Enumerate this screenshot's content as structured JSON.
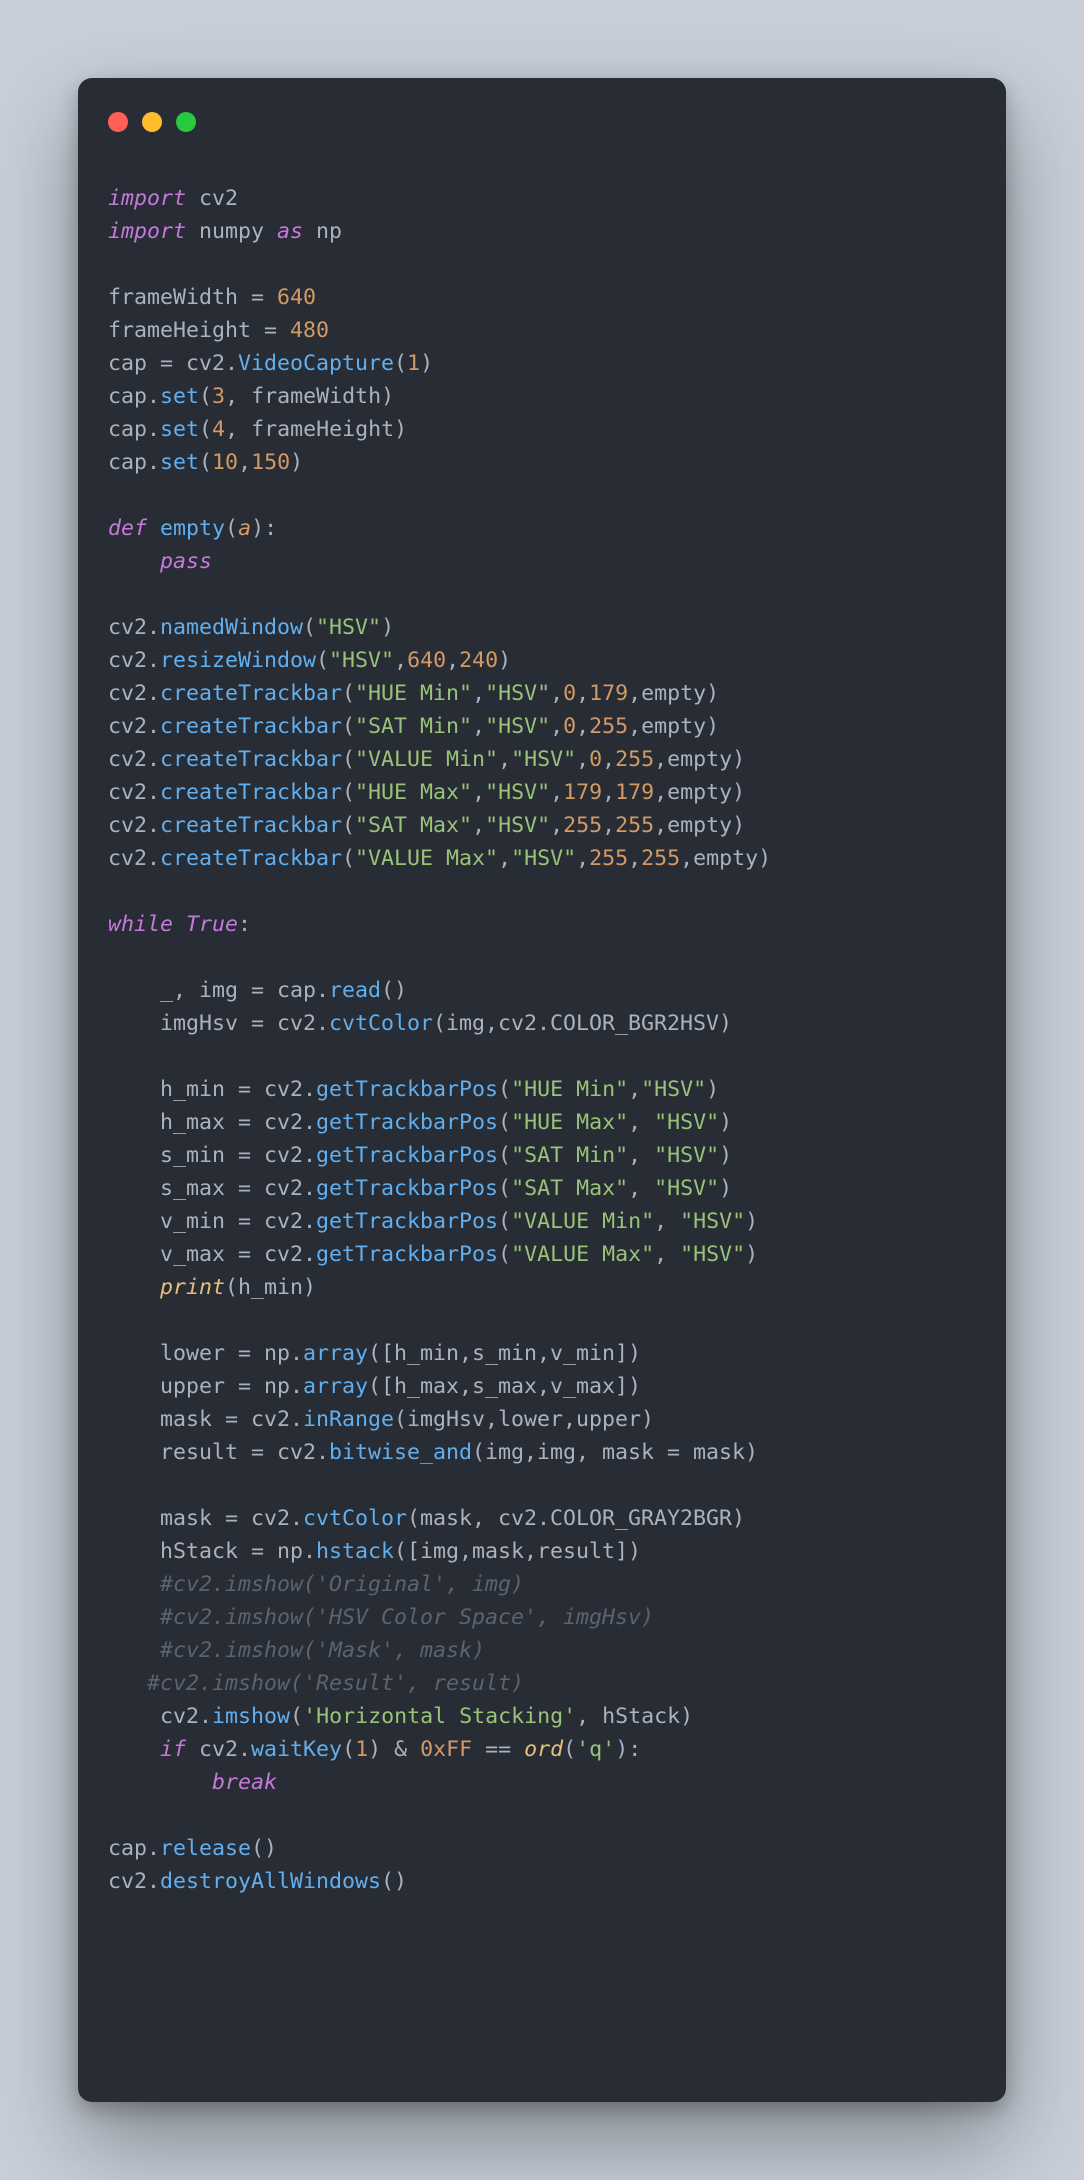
{
  "window": {
    "variant": "mac",
    "dots": [
      "red",
      "yellow",
      "green"
    ]
  },
  "code": {
    "l01_import": "import",
    "l01_cv2": " cv2",
    "l02_import": "import",
    "l02_numpy": " numpy ",
    "l02_as": "as",
    "l02_np": " np",
    "l04_fw": "frameWidth = ",
    "l04_640": "640",
    "l05_fh": "frameHeight = ",
    "l05_480": "480",
    "l06_a": "cap = cv2.",
    "l06_vc": "VideoCapture",
    "l06_p1": "(",
    "l06_1": "1",
    "l06_p2": ")",
    "l07_a": "cap.",
    "l07_set": "set",
    "l07_p1": "(",
    "l07_3": "3",
    "l07_p2": ", frameWidth)",
    "l08_a": "cap.",
    "l08_set": "set",
    "l08_p1": "(",
    "l08_4": "4",
    "l08_p2": ", frameHeight)",
    "l09_a": "cap.",
    "l09_set": "set",
    "l09_p1": "(",
    "l09_10": "10",
    "l09_c": ",",
    "l09_150": "150",
    "l09_p2": ")",
    "l11_def": "def",
    "l11_sp": " ",
    "l11_empty": "empty",
    "l11_p1": "(",
    "l11_a": "a",
    "l11_p2": "):",
    "l12_ind": "    ",
    "l12_pass": "pass",
    "l14_a": "cv2.",
    "l14_nw": "namedWindow",
    "l14_p1": "(",
    "l14_s": "\"HSV\"",
    "l14_p2": ")",
    "l15_a": "cv2.",
    "l15_rw": "resizeWindow",
    "l15_p1": "(",
    "l15_s": "\"HSV\"",
    "l15_c1": ",",
    "l15_640": "640",
    "l15_c2": ",",
    "l15_240": "240",
    "l15_p2": ")",
    "l16_a": "cv2.",
    "l16_ct": "createTrackbar",
    "l16_p1": "(",
    "l16_s1": "\"HUE Min\"",
    "l16_c1": ",",
    "l16_s2": "\"HSV\"",
    "l16_c2": ",",
    "l16_0": "0",
    "l16_c3": ",",
    "l16_179": "179",
    "l16_p2": ",empty)",
    "l17_a": "cv2.",
    "l17_ct": "createTrackbar",
    "l17_p1": "(",
    "l17_s1": "\"SAT Min\"",
    "l17_c1": ",",
    "l17_s2": "\"HSV\"",
    "l17_c2": ",",
    "l17_0": "0",
    "l17_c3": ",",
    "l17_255": "255",
    "l17_p2": ",empty)",
    "l18_a": "cv2.",
    "l18_ct": "createTrackbar",
    "l18_p1": "(",
    "l18_s1": "\"VALUE Min\"",
    "l18_c1": ",",
    "l18_s2": "\"HSV\"",
    "l18_c2": ",",
    "l18_0": "0",
    "l18_c3": ",",
    "l18_255": "255",
    "l18_p2": ",empty)",
    "l19_a": "cv2.",
    "l19_ct": "createTrackbar",
    "l19_p1": "(",
    "l19_s1": "\"HUE Max\"",
    "l19_c1": ",",
    "l19_s2": "\"HSV\"",
    "l19_c2": ",",
    "l19_179a": "179",
    "l19_c3": ",",
    "l19_179b": "179",
    "l19_p2": ",empty)",
    "l20_a": "cv2.",
    "l20_ct": "createTrackbar",
    "l20_p1": "(",
    "l20_s1": "\"SAT Max\"",
    "l20_c1": ",",
    "l20_s2": "\"HSV\"",
    "l20_c2": ",",
    "l20_255a": "255",
    "l20_c3": ",",
    "l20_255b": "255",
    "l20_p2": ",empty)",
    "l21_a": "cv2.",
    "l21_ct": "createTrackbar",
    "l21_p1": "(",
    "l21_s1": "\"VALUE Max\"",
    "l21_c1": ",",
    "l21_s2": "\"HSV\"",
    "l21_c2": ",",
    "l21_255a": "255",
    "l21_c3": ",",
    "l21_255b": "255",
    "l21_p2": ",empty)",
    "l23_while": "while",
    "l23_sp": " ",
    "l23_true": "True",
    "l23_colon": ":",
    "l25_ind": "    ",
    "l25_txt": "_, img = cap.",
    "l25_read": "read",
    "l25_p": "()",
    "l26_ind": "    ",
    "l26_a": "imgHsv = cv2.",
    "l26_cvt": "cvtColor",
    "l26_p": "(img,cv2.COLOR_BGR2HSV)",
    "l28_ind": "    ",
    "l28_a": "h_min = cv2.",
    "l28_g": "getTrackbarPos",
    "l28_p1": "(",
    "l28_s1": "\"HUE Min\"",
    "l28_c": ",",
    "l28_s2": "\"HSV\"",
    "l28_p2": ")",
    "l29_ind": "    ",
    "l29_a": "h_max = cv2.",
    "l29_g": "getTrackbarPos",
    "l29_p1": "(",
    "l29_s1": "\"HUE Max\"",
    "l29_c": ", ",
    "l29_s2": "\"HSV\"",
    "l29_p2": ")",
    "l30_ind": "    ",
    "l30_a": "s_min = cv2.",
    "l30_g": "getTrackbarPos",
    "l30_p1": "(",
    "l30_s1": "\"SAT Min\"",
    "l30_c": ", ",
    "l30_s2": "\"HSV\"",
    "l30_p2": ")",
    "l31_ind": "    ",
    "l31_a": "s_max = cv2.",
    "l31_g": "getTrackbarPos",
    "l31_p1": "(",
    "l31_s1": "\"SAT Max\"",
    "l31_c": ", ",
    "l31_s2": "\"HSV\"",
    "l31_p2": ")",
    "l32_ind": "    ",
    "l32_a": "v_min = cv2.",
    "l32_g": "getTrackbarPos",
    "l32_p1": "(",
    "l32_s1": "\"VALUE Min\"",
    "l32_c": ", ",
    "l32_s2": "\"HSV\"",
    "l32_p2": ")",
    "l33_ind": "    ",
    "l33_a": "v_max = cv2.",
    "l33_g": "getTrackbarPos",
    "l33_p1": "(",
    "l33_s1": "\"VALUE Max\"",
    "l33_c": ", ",
    "l33_s2": "\"HSV\"",
    "l33_p2": ")",
    "l34_ind": "    ",
    "l34_print": "print",
    "l34_p": "(h_min)",
    "l36_ind": "    ",
    "l36_a": "lower = np.",
    "l36_arr": "array",
    "l36_p": "([h_min,s_min,v_min])",
    "l37_ind": "    ",
    "l37_a": "upper = np.",
    "l37_arr": "array",
    "l37_p": "([h_max,s_max,v_max])",
    "l38_ind": "    ",
    "l38_a": "mask = cv2.",
    "l38_ir": "inRange",
    "l38_p": "(imgHsv,lower,upper)",
    "l39_ind": "    ",
    "l39_a": "result = cv2.",
    "l39_bw": "bitwise_and",
    "l39_p": "(img,img, mask = mask)",
    "l41_ind": "    ",
    "l41_a": "mask = cv2.",
    "l41_cvt": "cvtColor",
    "l41_p": "(mask, cv2.COLOR_GRAY2BGR)",
    "l42_ind": "    ",
    "l42_a": "hStack = np.",
    "l42_hs": "hstack",
    "l42_p": "([img,mask,result])",
    "l43": "    #cv2.imshow('Original', img)",
    "l44": "    #cv2.imshow('HSV Color Space', imgHsv)",
    "l45": "    #cv2.imshow('Mask', mask)",
    "l46": "   #cv2.imshow('Result', result)",
    "l47_ind": "    ",
    "l47_a": "cv2.",
    "l47_im": "imshow",
    "l47_p1": "(",
    "l47_s": "'Horizontal Stacking'",
    "l47_p2": ", hStack)",
    "l48_ind": "    ",
    "l48_if": "if",
    "l48_a": " cv2.",
    "l48_wk": "waitKey",
    "l48_p1": "(",
    "l48_1": "1",
    "l48_p2": ") & ",
    "l48_0xff": "0xFF",
    "l48_eq": " == ",
    "l48_ord": "ord",
    "l48_p3": "(",
    "l48_q": "'q'",
    "l48_p4": "):",
    "l49_ind": "        ",
    "l49_break": "break",
    "l51_a": "cap.",
    "l51_rel": "release",
    "l51_p": "()",
    "l52_a": "cv2.",
    "l52_daw": "destroyAllWindows",
    "l52_p": "()"
  }
}
